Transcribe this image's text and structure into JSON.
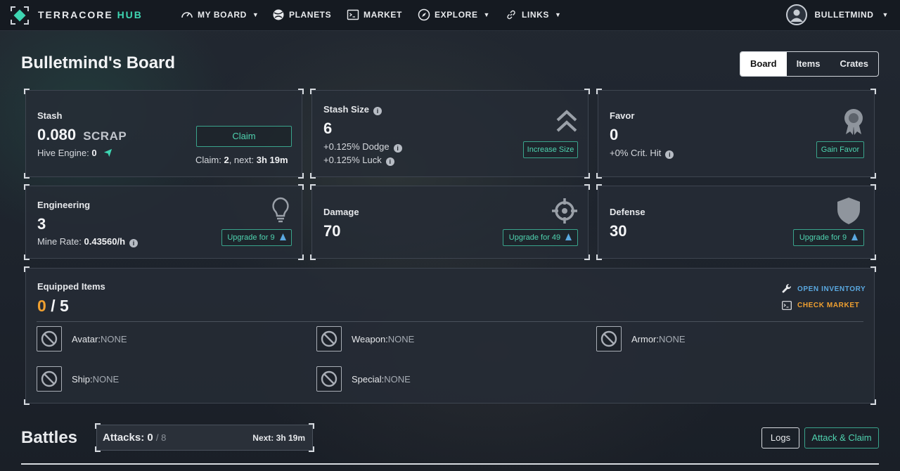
{
  "nav": {
    "brand_main": "TERRACORE",
    "brand_accent": "HUB",
    "items": [
      {
        "label": "MY BOARD",
        "icon": "gauge-icon",
        "has_caret": true
      },
      {
        "label": "PLANETS",
        "icon": "planet-icon",
        "has_caret": false
      },
      {
        "label": "MARKET",
        "icon": "terminal-icon",
        "has_caret": false
      },
      {
        "label": "EXPLORE",
        "icon": "compass-icon",
        "has_caret": true
      },
      {
        "label": "LINKS",
        "icon": "link-icon",
        "has_caret": true
      }
    ],
    "caret": "▼",
    "username": "BULLETMIND"
  },
  "page": {
    "title": "Bulletmind's Board",
    "tabs": [
      "Board",
      "Items",
      "Crates"
    ],
    "active_tab": "Board"
  },
  "stash": {
    "label": "Stash",
    "value": "0.080",
    "unit": "SCRAP",
    "hive_engine_label": "Hive Engine:",
    "hive_engine_value": "0",
    "claim_button": "Claim",
    "claim_label": "Claim:",
    "claim_count": "2",
    "next_label": ", next:",
    "next_value": "3h 19m"
  },
  "stash_size": {
    "label": "Stash Size",
    "value": "6",
    "dodge": "+0.125% Dodge",
    "luck": "+0.125% Luck",
    "button": "Increase Size"
  },
  "favor": {
    "label": "Favor",
    "value": "0",
    "crit": "+0% Crit. Hit",
    "button": "Gain Favor"
  },
  "engineering": {
    "label": "Engineering",
    "value": "3",
    "mine_rate_label": "Mine Rate:",
    "mine_rate_value": "0.43560/h",
    "button": "Upgrade for 9"
  },
  "damage": {
    "label": "Damage",
    "value": "70",
    "button": "Upgrade for 49"
  },
  "defense": {
    "label": "Defense",
    "value": "30",
    "button": "Upgrade for 9"
  },
  "equipped": {
    "label": "Equipped Items",
    "count": "0",
    "separator": "/",
    "max": "5",
    "open_inventory": "OPEN INVENTORY",
    "check_market": "CHECK MARKET",
    "slots": [
      {
        "name": "Avatar:",
        "value": "NONE"
      },
      {
        "name": "Weapon:",
        "value": "NONE"
      },
      {
        "name": "Armor:",
        "value": "NONE"
      },
      {
        "name": "Ship:",
        "value": "NONE"
      },
      {
        "name": "Special:",
        "value": "NONE"
      }
    ]
  },
  "battles": {
    "title": "Battles",
    "attacks_label": "Attacks:",
    "attacks_value": "0",
    "attacks_max": "/ 8",
    "next_label": "Next:",
    "next_value": "3h 19m",
    "logs_button": "Logs",
    "attack_button": "Attack & Claim"
  },
  "colors": {
    "accent_green": "#3ed6b2",
    "accent_orange": "#f0a030",
    "link_blue": "#5aa8e0",
    "background": "#1c222b"
  }
}
